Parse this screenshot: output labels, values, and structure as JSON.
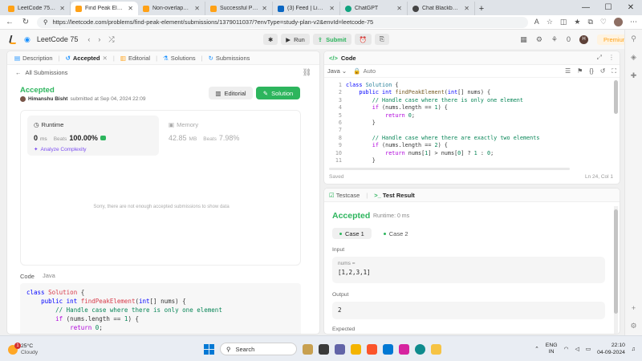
{
  "browser": {
    "tabs": [
      {
        "title": "LeetCode 75 - Study",
        "favicon": "leetcode",
        "active": false
      },
      {
        "title": "Find Peak Element",
        "favicon": "leetcode",
        "active": true
      },
      {
        "title": "Non-overlapping Int",
        "favicon": "leetcode",
        "active": false
      },
      {
        "title": "Successful Pairs of S",
        "favicon": "leetcode",
        "active": false
      },
      {
        "title": "(3) Feed | LinkedIn",
        "favicon": "linkedin",
        "active": false
      },
      {
        "title": "ChatGPT",
        "favicon": "chatgpt",
        "active": false
      },
      {
        "title": "Chat Blackbox: AI C",
        "favicon": "blackbox",
        "active": false
      }
    ],
    "url": "https://leetcode.com/problems/find-peak-element/submissions/1379011037/?envType=study-plan-v2&envId=leetcode-75"
  },
  "lcnav": {
    "title": "LeetCode 75",
    "run_label": "Run",
    "submit_label": "Submit",
    "coins": "0",
    "user_initial": "H",
    "premium_label": "Premium"
  },
  "left": {
    "tabs": {
      "description": "Description",
      "accepted": "Accepted",
      "editorial": "Editorial",
      "solutions": "Solutions",
      "submissions": "Submissions"
    },
    "all_submissions": "All Submissions",
    "status": "Accepted",
    "author": "Himanshu Bisht",
    "submitted_at": "submitted at Sep 04, 2024 22:09",
    "editorial_btn": "Editorial",
    "solution_btn": "Solution",
    "runtime": {
      "label": "Runtime",
      "value": "0",
      "unit": "ms",
      "beats_label": "Beats",
      "beats_value": "100.00%",
      "analyze": "Analyze Complexity"
    },
    "memory": {
      "label": "Memory",
      "value": "42.85",
      "unit": "MB",
      "beats_label": "Beats",
      "beats_value": "7.98%"
    },
    "not_enough": "Sorry, there are not enough accepted submissions to show data",
    "code_label": "Code",
    "code_lang": "Java"
  },
  "editor": {
    "title": "Code",
    "language": "Java",
    "mode": "Auto",
    "line_numbers": "1\n2\n3\n4\n5\n6\n7\n8\n9\n10\n11",
    "saved": "Saved",
    "cursor": "Ln 24, Col 1"
  },
  "result": {
    "testcase_tab": "Testcase",
    "result_tab": "Test Result",
    "status": "Accepted",
    "runtime": "Runtime: 0 ms",
    "case1": "Case 1",
    "case2": "Case 2",
    "input_label": "Input",
    "input_var": "nums =",
    "input_value": "[1,2,3,1]",
    "output_label": "Output",
    "output_value": "2",
    "expected_label": "Expected"
  },
  "taskbar": {
    "temp": "25°C",
    "weather": "Cloudy",
    "search": "Search",
    "lang_top": "ENG",
    "lang_bottom": "IN",
    "time": "22:10",
    "date": "04-09-2024"
  },
  "colors": {
    "accepted_green": "#2db55d",
    "leetcode_orange": "#ffa116",
    "analyze_purple": "#7a4cf0"
  }
}
